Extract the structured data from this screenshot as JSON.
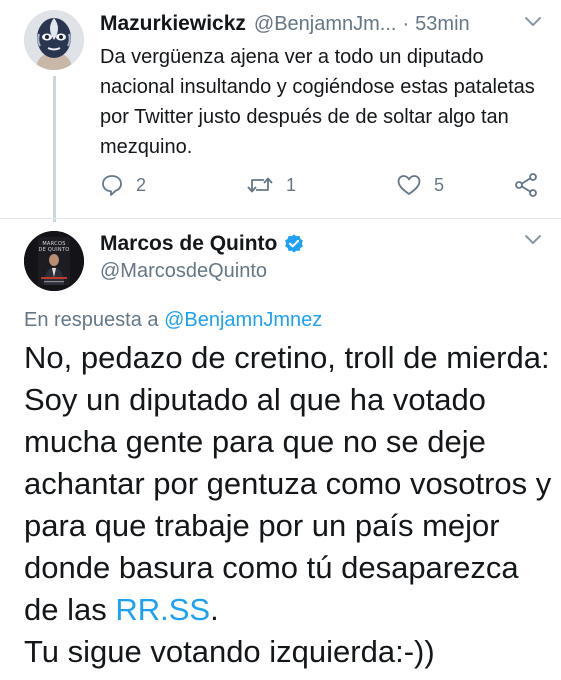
{
  "tweet1": {
    "display_name": "Mazurkiewickz",
    "handle": "@BenjamnJm...",
    "separator": "·",
    "time": "53min",
    "text": "Da vergüenza ajena ver a todo un diputado nacional insultando y cogiéndose estas pataletas por Twitter justo después de de soltar algo tan mezquino.",
    "replies": "2",
    "retweets": "1",
    "likes": "5",
    "icons": [
      "reply-icon",
      "retweet-icon",
      "like-icon",
      "share-icon",
      "chevron-down-icon"
    ]
  },
  "tweet2": {
    "display_name": "Marcos de Quinto",
    "handle": "@MarcosdeQuinto",
    "reply_prefix": "En respuesta a",
    "reply_mention": "@BenjamnJmnez",
    "text_part1": "No, pedazo de cretino, troll de mierda: Soy un diputado al que ha votado mucha gente para que no se deje achantar por gentuza como vosotros y para que trabaje por un país mejor donde basura como tú desaparezca de las ",
    "text_link": "RR.SS",
    "text_part2": ".",
    "text_line_last": "Tu sigue votando izquierda:-))",
    "avatar_lettering": "MARCOS DE QUINTO",
    "icons": [
      "verified-badge-icon",
      "chevron-down-icon"
    ]
  },
  "colors": {
    "link": "#1da1f2",
    "secondary_text": "#657786",
    "divider": "#e1e8ed"
  }
}
